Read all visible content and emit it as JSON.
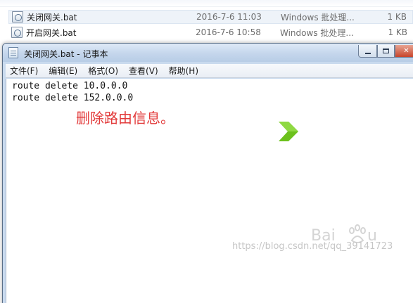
{
  "explorer": {
    "files": [
      {
        "name": "关闭网关.bat",
        "date": "2016-7-6 11:03",
        "type": "Windows 批处理...",
        "size": "1 KB"
      },
      {
        "name": "开启网关.bat",
        "date": "2016-7-6 10:58",
        "type": "Windows 批处理...",
        "size": "1 KB"
      }
    ]
  },
  "notepad": {
    "title": "关闭网关.bat - 记事本",
    "menu": [
      "文件(F)",
      "编辑(E)",
      "格式(O)",
      "查看(V)",
      "帮助(H)"
    ],
    "lines": [
      "route delete 10.0.0.0",
      "route delete 152.0.0.0"
    ]
  },
  "annotation": "删除路由信息。",
  "watermark": {
    "url": "https://blog.csdn.net/qq_39141723"
  },
  "colors": {
    "annotation": "#e23a3a",
    "arrow": "#6cc11c",
    "close_button": "#c7442a",
    "titlebar": "#c4d6ec"
  },
  "icons": [
    "bat-file-icon",
    "notepad-icon",
    "minimize-icon",
    "maximize-icon",
    "close-icon",
    "next-arrow-icon",
    "baidu-paw-icon"
  ]
}
